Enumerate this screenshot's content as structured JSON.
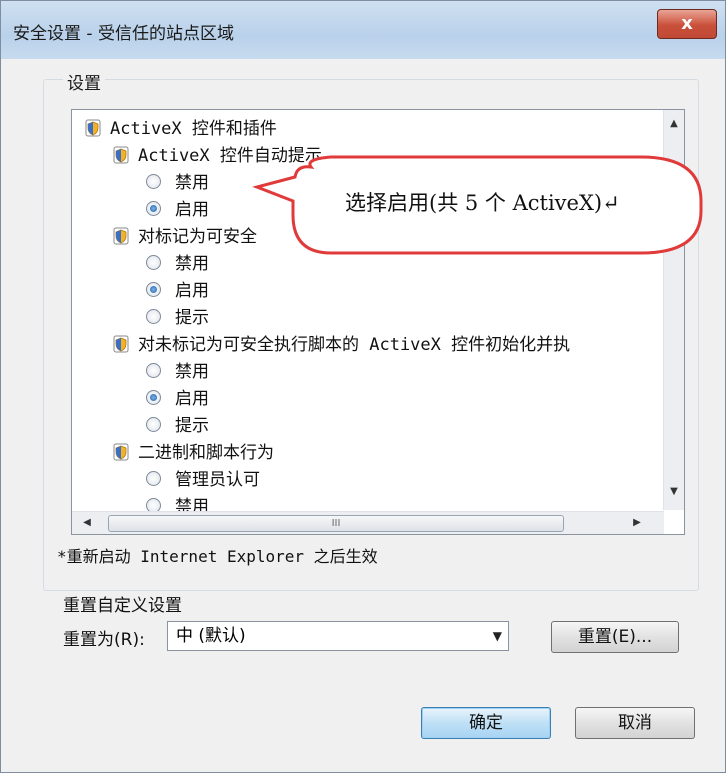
{
  "window": {
    "title": "安全设置 - 受信任的站点区域",
    "close_label": "x"
  },
  "settings_group": {
    "label": "设置"
  },
  "tree": [
    {
      "kind": "category",
      "label": "ActiveX 控件和插件"
    },
    {
      "kind": "item",
      "label": "ActiveX 控件自动提示"
    },
    {
      "kind": "option",
      "label": "禁用",
      "selected": false
    },
    {
      "kind": "option",
      "label": "启用",
      "selected": true
    },
    {
      "kind": "item",
      "label": "对标记为可安全"
    },
    {
      "kind": "option",
      "label": "禁用",
      "selected": false
    },
    {
      "kind": "option",
      "label": "启用",
      "selected": true
    },
    {
      "kind": "option",
      "label": "提示",
      "selected": false
    },
    {
      "kind": "item",
      "label": "对未标记为可安全执行脚本的 ActiveX 控件初始化并执"
    },
    {
      "kind": "option",
      "label": "禁用",
      "selected": false
    },
    {
      "kind": "option",
      "label": "启用",
      "selected": true
    },
    {
      "kind": "option",
      "label": "提示",
      "selected": false
    },
    {
      "kind": "item",
      "label": "二进制和脚本行为"
    },
    {
      "kind": "option",
      "label": "管理员认可",
      "selected": false
    },
    {
      "kind": "option",
      "label": "禁用",
      "selected": false
    }
  ],
  "hscroll_grip": "III",
  "restart_note": "*重新启动 Internet Explorer 之后生效",
  "reset_group": {
    "label": "重置自定义设置",
    "reset_to_label": "重置为(R):",
    "selected_value": "中 (默认)",
    "reset_button": "重置(E)..."
  },
  "buttons": {
    "ok": "确定",
    "cancel": "取消"
  },
  "callout": {
    "text": "选择启用(共 5 个 ActiveX)↵"
  },
  "icons": {
    "tree_item": "shield-icon",
    "scroll_up": "arrow-up-icon",
    "scroll_down": "arrow-down-icon",
    "scroll_left": "arrow-left-icon",
    "scroll_right": "arrow-right-icon",
    "dropdown": "chevron-down-icon"
  }
}
